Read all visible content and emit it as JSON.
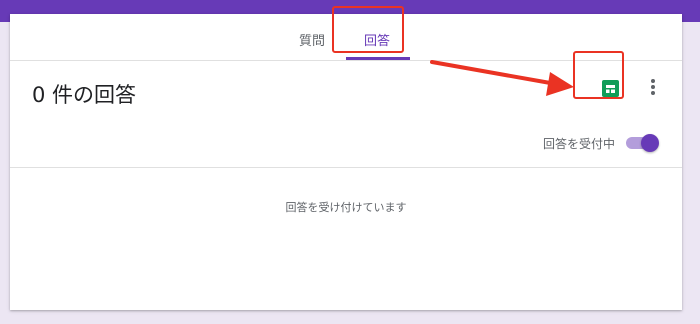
{
  "colors": {
    "brand": "#673ab7",
    "annotation": "#ea3323",
    "sheets_green": "#0f9d58"
  },
  "tabs": [
    {
      "label": "質問",
      "active": false
    },
    {
      "label": "回答",
      "active": true
    }
  ],
  "responses": {
    "title": "0 件の回答",
    "accepting_label": "回答を受付中",
    "accepting": true,
    "empty_message": "回答を受け付けています"
  },
  "icons": {
    "sheets": "google-sheets-icon",
    "more": "more-vert-icon"
  }
}
